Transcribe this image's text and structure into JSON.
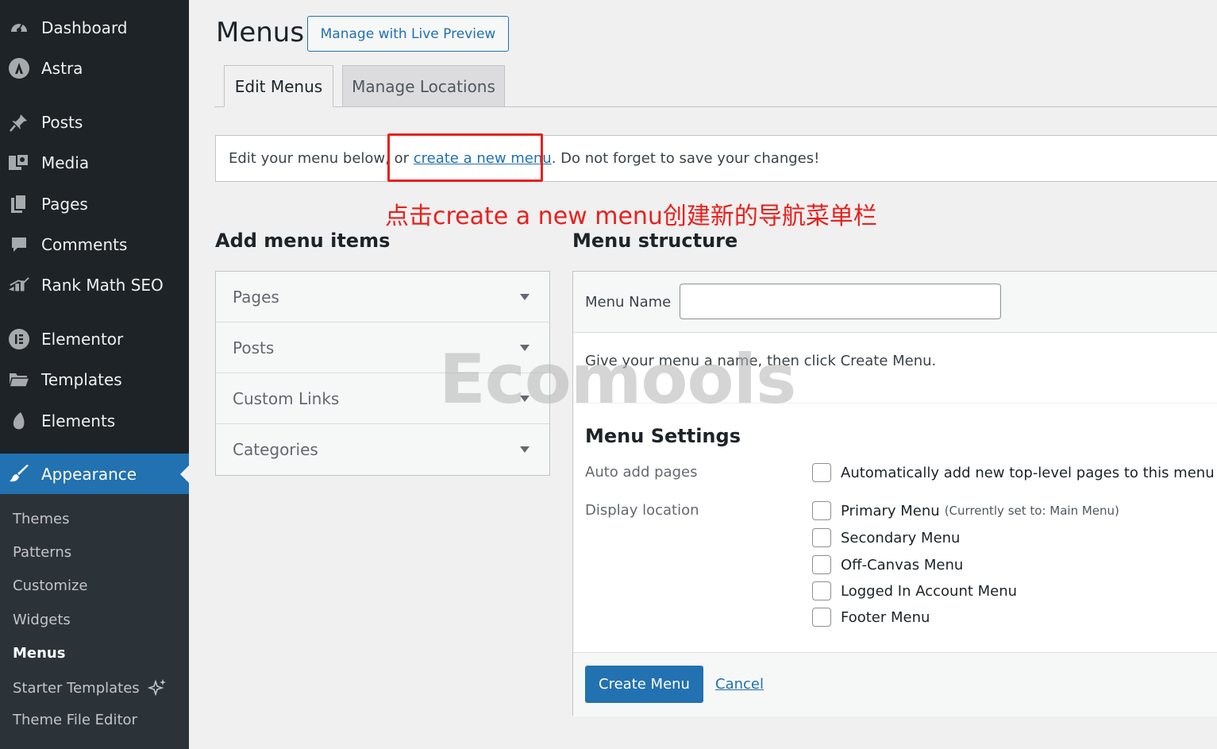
{
  "sidebar": {
    "items": [
      {
        "label": "Dashboard",
        "icon": "dashboard-icon"
      },
      {
        "label": "Astra",
        "icon": "astra-icon"
      },
      {
        "label": "Posts",
        "icon": "pin-icon"
      },
      {
        "label": "Media",
        "icon": "media-icon"
      },
      {
        "label": "Pages",
        "icon": "pages-icon"
      },
      {
        "label": "Comments",
        "icon": "comment-icon"
      },
      {
        "label": "Rank Math SEO",
        "icon": "rank-math-icon"
      },
      {
        "label": "Elementor",
        "icon": "elementor-icon"
      },
      {
        "label": "Templates",
        "icon": "folder-icon"
      },
      {
        "label": "Elements",
        "icon": "elements-icon"
      },
      {
        "label": "Appearance",
        "icon": "brush-icon",
        "active": true
      }
    ],
    "submenu": [
      {
        "label": "Themes"
      },
      {
        "label": "Patterns"
      },
      {
        "label": "Customize"
      },
      {
        "label": "Widgets"
      },
      {
        "label": "Menus",
        "current": true
      },
      {
        "label": "Starter Templates",
        "icon": "sparkle-icon"
      },
      {
        "label": "Theme File Editor"
      }
    ]
  },
  "header": {
    "title": "Menus",
    "live_preview_label": "Manage with Live Preview"
  },
  "tabs": [
    {
      "label": "Edit Menus",
      "active": true
    },
    {
      "label": "Manage Locations",
      "active": false
    }
  ],
  "notice": {
    "prefix": "Edit your menu below, or ",
    "link": "create a new menu",
    "suffix": ". Do not forget to save your changes!"
  },
  "annotation": "点击create a new menu创建新的导航菜单栏",
  "watermark": "Ecomools",
  "add_items": {
    "title": "Add menu items",
    "sections": [
      "Pages",
      "Posts",
      "Custom Links",
      "Categories"
    ]
  },
  "structure": {
    "title": "Menu structure",
    "name_label": "Menu Name",
    "name_value": "",
    "instructions": "Give your menu a name, then click Create Menu.",
    "settings_title": "Menu Settings",
    "auto_add_label": "Auto add pages",
    "auto_add_option": "Automatically add new top-level pages to this menu",
    "display_label": "Display location",
    "locations": [
      {
        "label": "Primary Menu",
        "note": "(Currently set to: Main Menu)"
      },
      {
        "label": "Secondary Menu",
        "note": ""
      },
      {
        "label": "Off-Canvas Menu",
        "note": ""
      },
      {
        "label": "Logged In Account Menu",
        "note": ""
      },
      {
        "label": "Footer Menu",
        "note": ""
      }
    ],
    "create_label": "Create Menu",
    "cancel_label": "Cancel"
  },
  "colors": {
    "sidebar_bg": "#1d2327",
    "accent": "#2271b1",
    "annotation_red": "#e8211c"
  }
}
